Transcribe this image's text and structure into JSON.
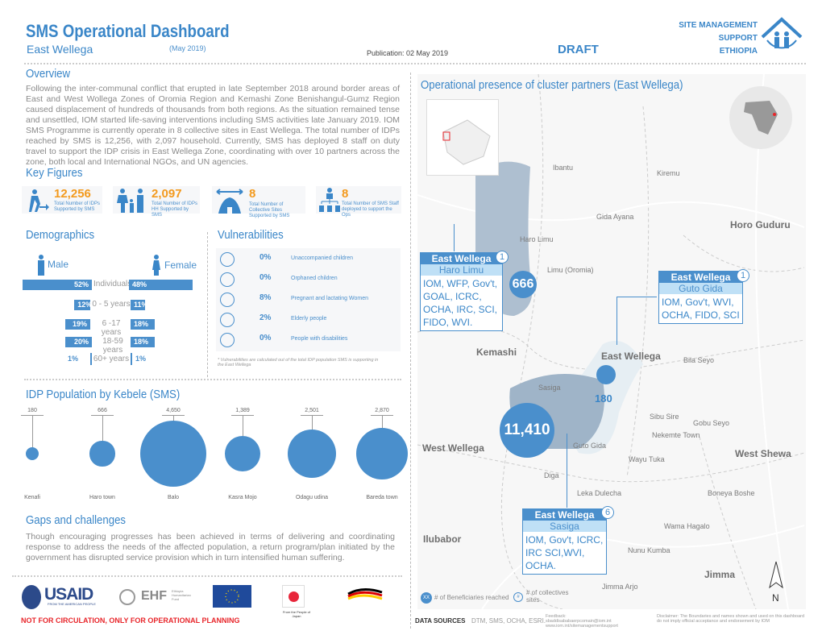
{
  "header": {
    "title": "SMS Operational Dashboard",
    "region": "East Wellega",
    "period": "(May 2019)",
    "publication": "Publication: 02 May 2019",
    "status": "DRAFT",
    "org_lines": [
      "SITE MANAGEMENT",
      "SUPPORT",
      "ETHIOPIA"
    ]
  },
  "overview": {
    "title": "Overview",
    "text": "Following the inter-communal conflict that erupted in late September 2018 around border areas of East and West Wollega Zones of Oromia Region and Kemashi Zone Benishangul-Gumz Region caused displacement of hundreds of thousands from both regions. As the situation remained tense and unsettled, IOM started life-saving interventions including SMS activities late January 2019. IOM SMS Programme is currently operate in 8 collective sites in East Wellega. The total number of IDPs reached by SMS is 12,256, with 2,097 household. Currently, SMS has deployed 8 staff on duty travel to support the IDP crisis in East Wellega Zone, coordinating with over 10 partners across the zone, both local and International NGOs, and UN agencies."
  },
  "key_figures": {
    "title": "Key Figures",
    "items": [
      {
        "value": "12,256",
        "label": "Total Number of IDPs Supported by SMS",
        "icon": "walking-person-arrow-icon"
      },
      {
        "value": "2,097",
        "label": "Total Number of IDPs HH Supported by SMS",
        "icon": "family-icon"
      },
      {
        "value": "8",
        "label": "Total Number of Collective Sites Supported by SMS",
        "icon": "tent-icon"
      },
      {
        "value": "8",
        "label": "Total Number of SMS Staff deployed to support the Ops",
        "icon": "staff-hierarchy-icon"
      }
    ]
  },
  "demographics": {
    "title": "Demographics",
    "male": "Male",
    "female": "Female",
    "rows": [
      {
        "label": "Individuals",
        "male": 52,
        "female": 48,
        "male_text": "52%",
        "female_text": "48%"
      },
      {
        "label": "0 - 5 years",
        "male": 12,
        "female": 11,
        "male_text": "12%",
        "female_text": "11%"
      },
      {
        "label": "6 -17 years",
        "male": 19,
        "female": 18,
        "male_text": "19%",
        "female_text": "18%"
      },
      {
        "label": "18-59 years",
        "male": 20,
        "female": 18,
        "male_text": "20%",
        "female_text": "18%"
      },
      {
        "label": "60+ years",
        "male": 1,
        "female": 1,
        "male_text": "1%",
        "female_text": "1%"
      }
    ]
  },
  "vulnerabilities": {
    "title": "Vulnerabilities",
    "items": [
      {
        "pct": "0%",
        "label": "Unaccompanied children"
      },
      {
        "pct": "0%",
        "label": "Orphaned children"
      },
      {
        "pct": "8%",
        "label": "Pregnant and lactating Women"
      },
      {
        "pct": "2%",
        "label": "Elderly people"
      },
      {
        "pct": "0%",
        "label": "People with disabilities"
      }
    ],
    "note": "* Vulnerabilities are calculated out of the total IDP population SMS is supporting in the East Wellega"
  },
  "idp": {
    "title": "IDP Population by Kebele (SMS)",
    "items": [
      {
        "name": "Kenafi",
        "value": 180,
        "text": "180"
      },
      {
        "name": "Haro town",
        "value": 666,
        "text": "666"
      },
      {
        "name": "Balo",
        "value": 4650,
        "text": "4,650"
      },
      {
        "name": "Kasra Mojo",
        "value": 1389,
        "text": "1,389"
      },
      {
        "name": "Odagu udina",
        "value": 2501,
        "text": "2,501"
      },
      {
        "name": "Bareda town",
        "value": 2870,
        "text": "2,870"
      }
    ]
  },
  "gaps": {
    "title": "Gaps and challenges",
    "text": "Though encouraging progresses has been achieved in terms of delivering and coordinating response to address the needs of the affected population, a return program/plan initiated by the government has disrupted service provision which in turn intensified human suffering."
  },
  "footer": {
    "warning": "NOT FOR CIRCULATION, ONLY FOR OPERATIONAL PLANNING",
    "logos": [
      "USAID",
      "FROM THE AMERICAN PEOPLE",
      "EHF",
      "Ethiopia Humanitarian Fund",
      "From the People of Japan"
    ],
    "data_sources_label": "DATA SOURCES",
    "data_sources": "DTM, SMS, OCHA, ESRI.",
    "feedback": "Feedback: sbaddisababaerpcomain@iom.int www.iom.int/sitemanagementsupport",
    "disclaimer": "Disclaimer: The Boundaries and names shown and used on this dashboard do not imply official acceptance and endorsement by IOM"
  },
  "map": {
    "title": "Operational presence of cluster partners (East Wellega)",
    "legend": {
      "xx": "XX",
      "beneficiaries": "# of Beneficiaries reached",
      "collectives": "# of collectives sites",
      "collective_symbol": "#"
    },
    "north": "N",
    "places": [
      "Ibantu",
      "Kiremu",
      "Gida Ayana",
      "Haro Limu",
      "Limu (Oromia)",
      "Bila Seyo",
      "Sasiga",
      "Sibu Sire",
      "Gobu Seyo",
      "Nekemte Town",
      "Guto Gida",
      "Wayu Tuka",
      "Diga",
      "Leka Dulecha",
      "Boneya Boshe",
      "Wama Hagalo",
      "Nunu Kumba",
      "Jimma Arjo"
    ],
    "zones": [
      "Horo Guduru",
      "Kemashi",
      "East Wellega",
      "West Wellega",
      "West Shewa",
      "Ilubabor",
      "Jimma"
    ],
    "bubbles": [
      {
        "value": "666"
      },
      {
        "value": "180"
      },
      {
        "value": "11,410"
      }
    ],
    "callouts": [
      {
        "zone": "East Wellega",
        "woreda": "Haro Limu",
        "count": "1",
        "partners": "IOM, WFP, Gov't, GOAL, ICRC, OCHA, IRC, SCI, FIDO, WVI."
      },
      {
        "zone": "East Wellega",
        "woreda": "Guto Gida",
        "count": "1",
        "partners": "IOM, Gov't, WVI, OCHA, FIDO, SCI"
      },
      {
        "zone": "East Wellega",
        "woreda": "Sasiga",
        "count": "6",
        "partners": "IOM, Gov't, ICRC, IRC SCI,WVI, OCHA."
      }
    ]
  },
  "colors": {
    "accent": "#4a8fcc",
    "orange": "#f39a1e",
    "red": "#e8262b"
  }
}
